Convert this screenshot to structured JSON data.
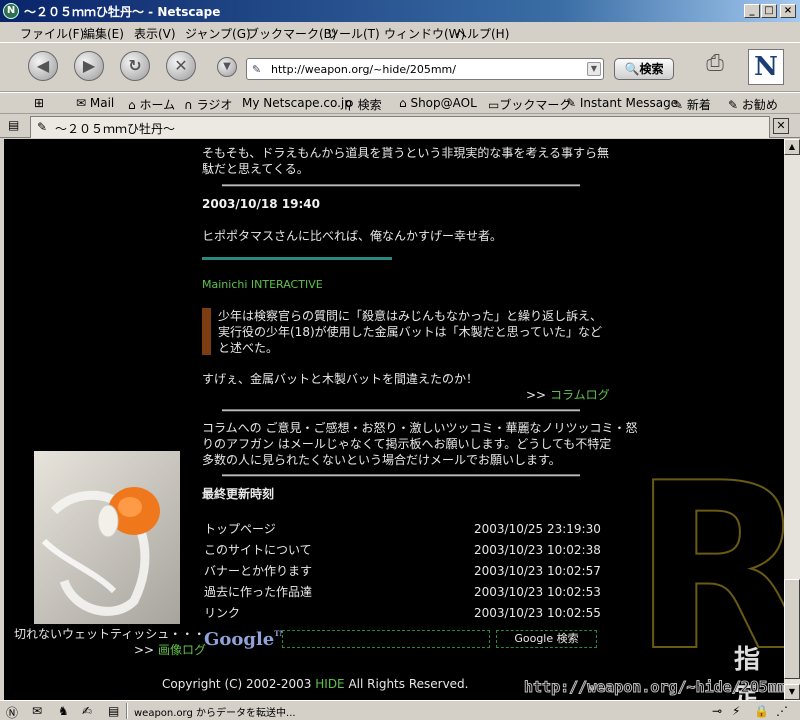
{
  "window": {
    "title": "～２０５ｍｍひ牡丹～ - Netscape"
  },
  "menu": [
    "ファイル(F)",
    "編集(E)",
    "表示(V)",
    "ジャンプ(G)",
    "ブックマーク(B)",
    "ツール(T)",
    "ウィンドウ(W)",
    "ヘルプ(H)"
  ],
  "nav": {
    "url": "http://weapon.org/~hide/205mm/",
    "search_label": "検索"
  },
  "personal_toolbar": [
    "Mail",
    "ホーム",
    "ラジオ",
    "Netscape.co.jp",
    "検索",
    "Shop@AOL",
    "ブックマーク",
    "Instant Message",
    "新着",
    "お勧め"
  ],
  "tab": {
    "title": "～２０５ｍｍひ牡丹～"
  },
  "content": {
    "prev_text": [
      "そもそも、ドラえもんから道具を貰うという非現実的な事を考える事すら無",
      "駄だと思えてくる。"
    ],
    "date_heading": "2003/10/18 19:40",
    "para1": "ヒポポタマスさんに比べれば、俺なんかすげー幸せ者。",
    "source_link": "Mainichi INTERACTIVE",
    "quote": [
      "少年は検察官らの質問に「殺意はみじんもなかった」と繰り返し訴え、",
      "実行役の少年(18)が使用した金属バットは「木製だと思っていた」など",
      "と述べた。"
    ],
    "para2": "すげぇ、金属バットと木製バットを間違えたのか！",
    "column_log_arrow": ">>",
    "column_log": "コラムログ",
    "column_intro": [
      "コラムへの ご意見・ご感想・お怒り・激しいツッコミ・華麗なノリツッコミ・怒",
      "りのアフガン はメールじゃなくて掲示板へお願いします。どうしても不特定",
      "多数の人に見られたくないという場合だけメールでお願いします。"
    ],
    "updates_heading": "最終更新時刻",
    "updates": [
      {
        "page": "トップページ",
        "time": "2003/10/25 23:19:30"
      },
      {
        "page": "このサイトについて",
        "time": "2003/10/23 10:02:38"
      },
      {
        "page": "バナーとか作ります",
        "time": "2003/10/23 10:02:57"
      },
      {
        "page": "過去に作った作品達",
        "time": "2003/10/23 10:02:53"
      },
      {
        "page": "リンク",
        "time": "2003/10/23 10:02:55"
      }
    ],
    "google_logo": "Google",
    "google_tm": "TM",
    "google_search_button": "Google 検索",
    "photo_caption": "切れないウェットティッシュ・・・",
    "image_log_arrow": ">>",
    "image_log": "画像ログ",
    "copyright_prefix": "Copyright (C) 2002-2003",
    "copyright_author": "HIDE",
    "copyright_suffix": "All Rights Reserved.",
    "big_letter": "R",
    "sidebar_text": "指定",
    "watermark": "http://weapon.org/~hide/205mm"
  },
  "statusbar": {
    "message": "weapon.org からデータを転送中..."
  },
  "colors": {
    "link_green": "#5ec24a",
    "content_bg": "#000000",
    "quote_bar": "#7c3d12",
    "teal_rule": "#2a8a80"
  }
}
